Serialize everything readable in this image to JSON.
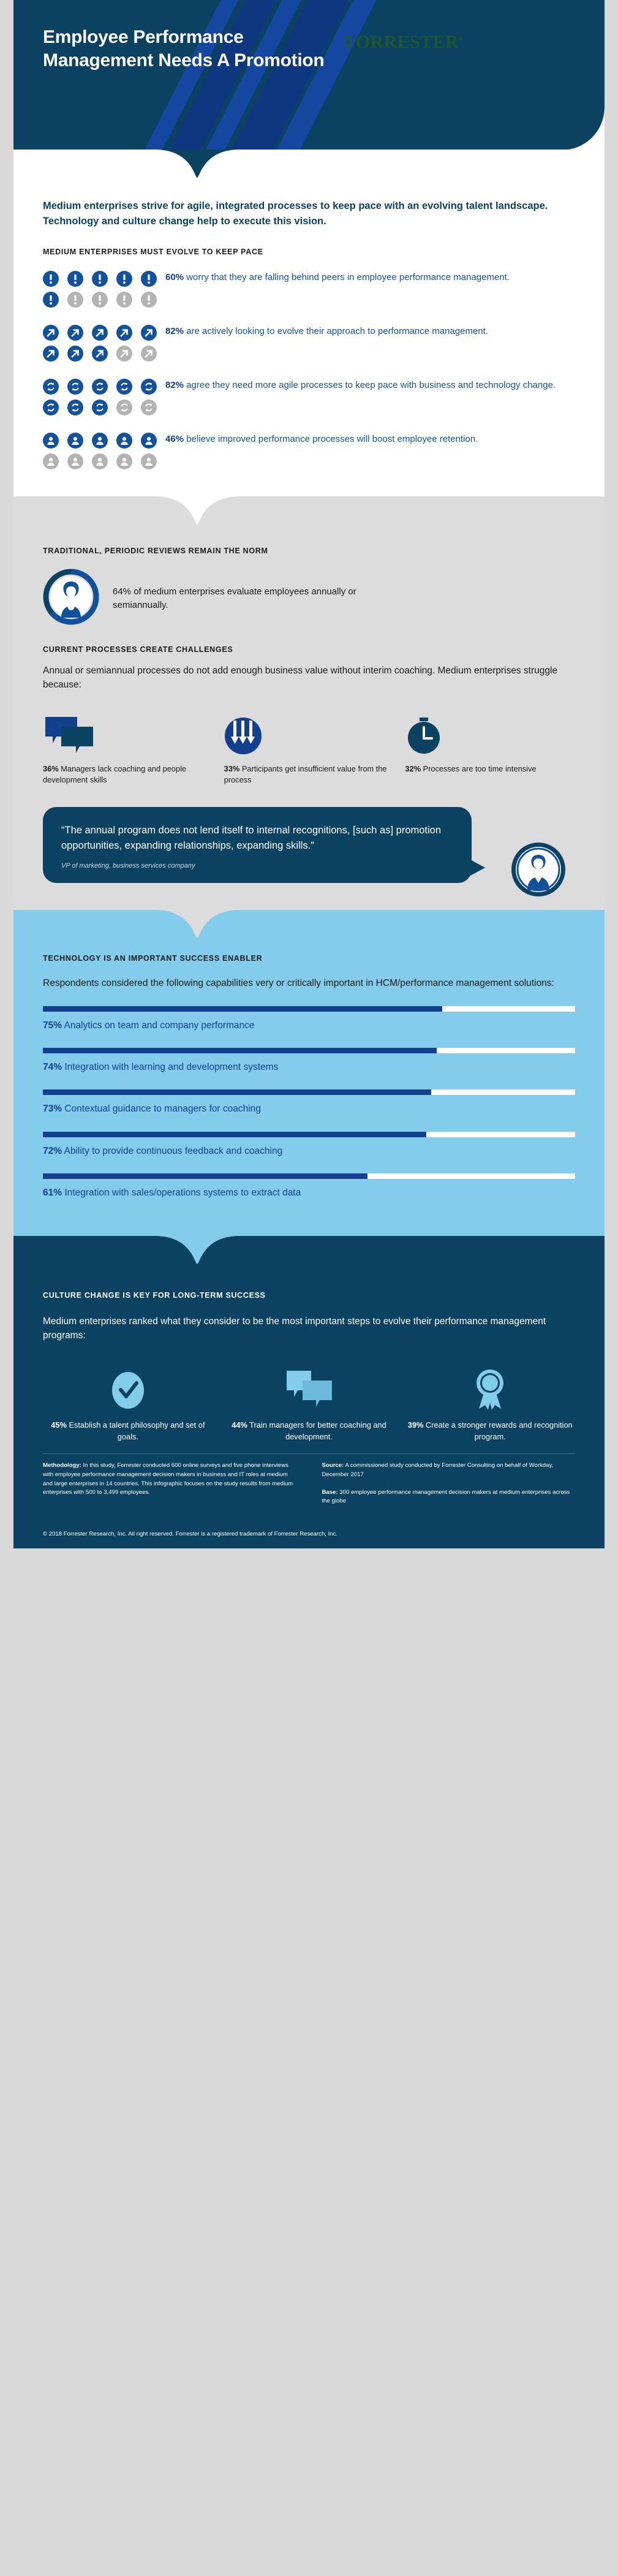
{
  "colors": {
    "dark_navy": "#0b4161",
    "brand_blue": "#123f8e",
    "light_blue": "#83ccec",
    "gray_band": "#dcdcdc",
    "muted_gray": "#b3b3b3",
    "forrester_green": "#1e5631",
    "page_bg": "#d9d9d9"
  },
  "header": {
    "title": "Employee Performance Management Needs A Promotion",
    "logo": "FORRESTER",
    "logo_mark": "®"
  },
  "intro": {
    "lead": "Medium enterprises strive for agile, integrated processes to keep pace with an evolving talent landscape. Technology and culture change help to execute this vision."
  },
  "evolve_section": {
    "kicker": "MEDIUM ENTERPRISES MUST EVOLVE TO KEEP PACE",
    "total_pips": 10,
    "stats": [
      {
        "percent": "60%",
        "text": "worry that they are falling behind peers in employee performance management.",
        "filled": 6,
        "icon": "exclamation-icon"
      },
      {
        "percent": "82%",
        "text": "are actively looking to evolve their approach to performance management.",
        "filled": 8,
        "icon": "arrow-up-right-icon"
      },
      {
        "percent": "82%",
        "text": "agree they need more agile processes to keep pace with business and technology change.",
        "filled": 8,
        "icon": "refresh-cycle-icon"
      },
      {
        "percent": "46%",
        "text": "believe improved performance processes will boost employee retention.",
        "filled": 5,
        "icon": "person-badge-icon"
      }
    ]
  },
  "reviews_section": {
    "kicker": "TRADITIONAL, PERIODIC REVIEWS REMAIN THE NORM",
    "stat_text": "64% of medium enterprises evaluate employees annually or semiannually.",
    "donut_value": 64,
    "avatar_icon": "person-avatar-icon"
  },
  "challenges_section": {
    "kicker": "CURRENT PROCESSES CREATE CHALLENGES",
    "body": "Annual or semiannual processes do not add enough business value without interim coaching. Medium enterprises struggle because:",
    "items": [
      {
        "percent": "36%",
        "text": "Managers lack coaching and people development skills",
        "icon": "chat-bubbles-icon"
      },
      {
        "percent": "33%",
        "text": "Participants get insufficient value from the process",
        "icon": "down-arrows-circle-icon"
      },
      {
        "percent": "32%",
        "text": "Processes are too time intensive",
        "icon": "clock-icon"
      }
    ]
  },
  "quote": {
    "text": "“The annual program does not lend itself to internal recognitions, [such as] promotion opportunities, expanding relationships, expanding skills.”",
    "attribution": "VP of marketing, business services company",
    "avatar_icon": "person-suit-avatar-icon"
  },
  "technology_section": {
    "kicker": "TECHNOLOGY IS AN IMPORTANT SUCCESS ENABLER",
    "body": "Respondents considered the following capabilities very or critically important in HCM/performance management solutions:"
  },
  "culture_section": {
    "kicker": "CULTURE CHANGE IS KEY FOR LONG-TERM SUCCESS",
    "body": "Medium enterprises ranked what they consider to be the most important steps to evolve their performance management programs:",
    "items": [
      {
        "percent": "45%",
        "text": "Establish a talent philosophy and set of goals.",
        "icon": "check-circle-icon"
      },
      {
        "percent": "44%",
        "text": "Train managers for better coaching and development.",
        "icon": "chat-bubbles-icon"
      },
      {
        "percent": "39%",
        "text": "Create a stronger rewards and recognition program.",
        "icon": "award-ribbon-icon"
      }
    ]
  },
  "footer": {
    "methodology_label": "Methodology:",
    "methodology_text": " In this study, Forrester conducted 600 online surveys and five phone interviews with employee performance management decision makers in business and IT roles at medium and large enterprises in 14 countries. This infographic focuses on the study results from medium enterprises with 500 to 3,499 employees.",
    "source_label": "Source:",
    "source_text": " A commissioned study conducted by Forrester Consulting on behalf of Workday, December 2017",
    "base_label": "Base:",
    "base_text": " 300 employee performance management decision makers at medium enterprises across the globe",
    "copyright": "© 2018 Forrester Research, Inc. All right reserved. Forrester is a registered trademark of Forrester Research, Inc."
  },
  "chart_data": {
    "type": "bar",
    "title": "Respondents considered the following capabilities very or critically important in HCM/performance management solutions:",
    "orientation": "horizontal",
    "xlabel": "",
    "ylabel": "",
    "xlim": [
      0,
      100
    ],
    "grid": false,
    "legend": false,
    "categories": [
      "Analytics on team and company performance",
      "Integration with learning and development systems",
      "Contextual guidance to managers for coaching",
      "Ability to provide continuous feedback and coaching",
      "Integration with sales/operations systems to extract data"
    ],
    "values": [
      75,
      74,
      73,
      72,
      61
    ],
    "labels": [
      "75%",
      "74%",
      "73%",
      "72%",
      "61%"
    ],
    "bar_color": "#123f8e",
    "track_color": "#ffffff",
    "background": "#83ccec"
  }
}
